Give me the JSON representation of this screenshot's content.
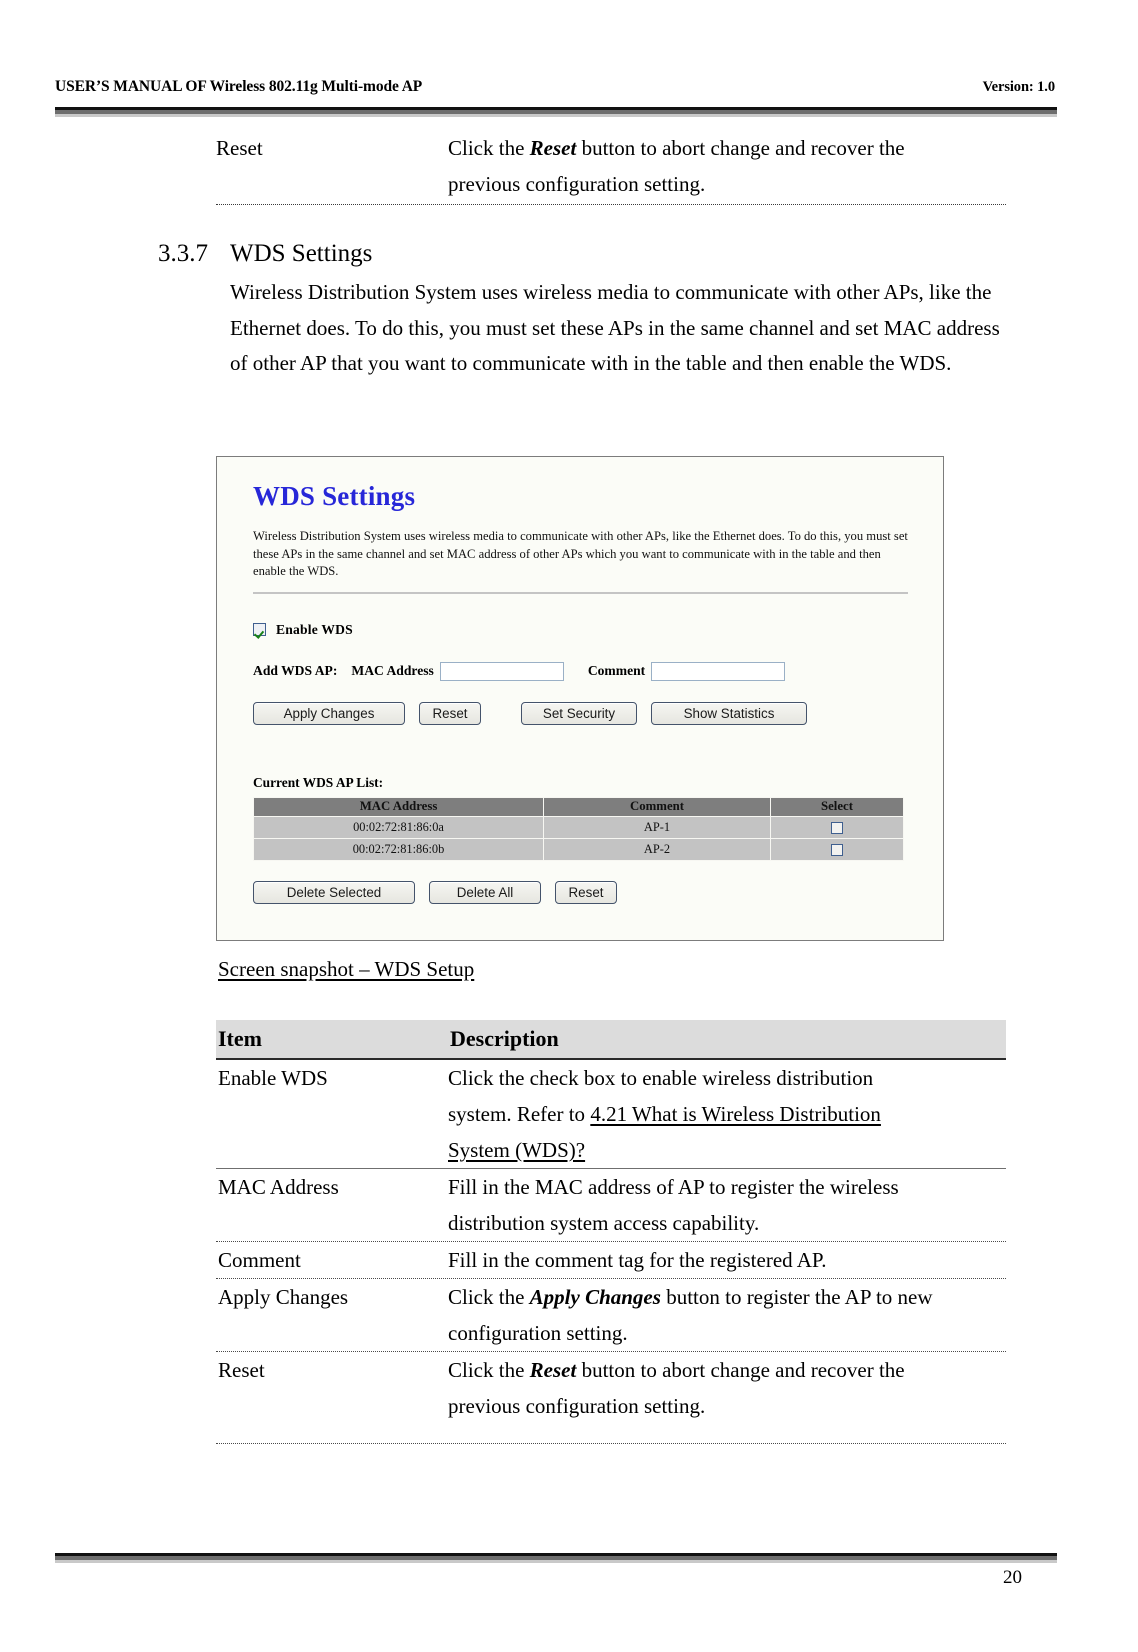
{
  "header": {
    "left": "USER’S MANUAL OF Wireless 802.11g Multi-mode AP",
    "right": "Version: 1.0"
  },
  "continued_row": {
    "item": "Reset",
    "desc_prefix": "Click the ",
    "desc_bold": "Reset",
    "desc_suffix": " button to abort change and recover the",
    "desc_line2": "previous configuration setting."
  },
  "section": {
    "number": "3.3.7",
    "title": "WDS Settings",
    "body": "Wireless Distribution System uses wireless media to communicate with other APs, like the Ethernet does. To do this, you must set these APs in the same channel and set MAC address of other AP that you want to communicate with in the table and then enable the WDS."
  },
  "screenshot": {
    "title": "WDS Settings",
    "description": "Wireless Distribution System uses wireless media to communicate with other APs, like the Ethernet does. To do this, you must set these APs in the same channel and set MAC address of other APs which you want to communicate with in the table and then enable the WDS.",
    "enable_wds": {
      "label": "Enable WDS",
      "checked": "true",
      "icon": "checkbox-checked-icon"
    },
    "add_ap": {
      "row_label": "Add WDS AP:",
      "mac_label": "MAC Address",
      "mac_value": "",
      "mac_placeholder": "",
      "comment_label": "Comment",
      "comment_value": "",
      "comment_placeholder": ""
    },
    "buttons": {
      "apply_changes": "Apply Changes",
      "reset": "Reset",
      "set_security": "Set Security",
      "show_statistics": "Show Statistics"
    },
    "list": {
      "label": "Current WDS AP List:",
      "columns": [
        "MAC Address",
        "Comment",
        "Select"
      ],
      "rows": [
        {
          "mac": "00:02:72:81:86:0a",
          "comment": "AP-1",
          "selected": "false"
        },
        {
          "mac": "00:02:72:81:86:0b",
          "comment": "AP-2",
          "selected": "false"
        }
      ]
    },
    "bottom_buttons": {
      "delete_selected": "Delete Selected",
      "delete_all": "Delete All",
      "reset": "Reset"
    },
    "colors": {
      "title_blue": "#2727d8",
      "panel_bg": "#fbfcf7",
      "table_header_gray": "#7e7e7e",
      "table_row_gray": "#c3c3c3"
    }
  },
  "caption": "Screen snapshot – WDS Setup",
  "desc_table": {
    "headers": {
      "item": "Item",
      "description": "Description"
    },
    "rows": [
      {
        "item": "Enable WDS",
        "lines": [
          {
            "text": "Click the check box to enable wireless distribution"
          },
          {
            "text": "system. Refer to ",
            "link": "4.21 What is Wireless Distribution "
          },
          {
            "link": "System (WDS)?"
          }
        ]
      },
      {
        "item": "MAC Address",
        "lines": [
          {
            "text": "Fill in the MAC address of AP to register the wireless"
          },
          {
            "text": "distribution system access capability."
          }
        ]
      },
      {
        "item": "Comment",
        "lines": [
          {
            "text": "Fill in the comment tag for the registered AP."
          }
        ]
      },
      {
        "item": "Apply Changes",
        "lines": [
          {
            "text": "Click the ",
            "bold": "Apply Changes",
            "text2": " button to register the AP to new"
          },
          {
            "text": "configuration setting."
          }
        ]
      },
      {
        "item": "Reset",
        "lines": [
          {
            "text": "Click the ",
            "bold": "Reset",
            "text2": " button to abort change and recover the"
          },
          {
            "text": "previous configuration setting."
          }
        ]
      }
    ]
  },
  "footer": {
    "page_number": "20"
  }
}
